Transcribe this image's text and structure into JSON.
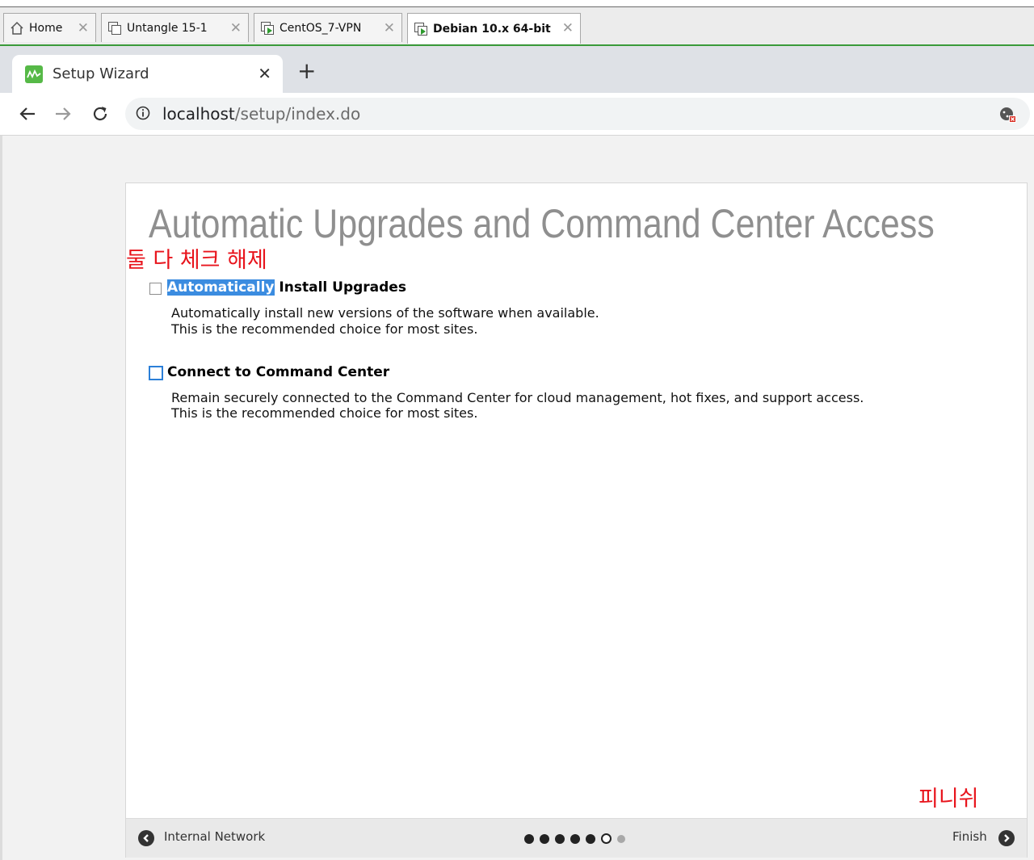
{
  "vm_tabs": [
    {
      "label": "Home",
      "icon": "home-icon"
    },
    {
      "label": "Untangle 15-1",
      "icon": "vm-icon"
    },
    {
      "label": "CentOS_7-VPN",
      "icon": "vm-running-icon"
    },
    {
      "label": "Debian 10.x 64-bit",
      "icon": "vm-running-icon",
      "active": true
    }
  ],
  "browser": {
    "tab_title": "Setup Wizard",
    "url_host": "localhost",
    "url_path": "/setup/index.do"
  },
  "wizard": {
    "title": "Automatic Upgrades and Command Center Access",
    "options": [
      {
        "label_highlight": "Automatically",
        "label_rest": " Install Upgrades",
        "checked": false,
        "desc_line1": "Automatically install new versions of the software when available.",
        "desc_line2": "This is the recommended choice for most sites."
      },
      {
        "label": "Connect to Command Center",
        "checked": false,
        "desc_line1": "Remain securely connected to the Command Center for cloud management, hot fixes, and support access.",
        "desc_line2": "This is the recommended choice for most sites."
      }
    ],
    "footer": {
      "prev_label": "Internal Network",
      "next_label": "Finish",
      "steps_completed": 5,
      "current_step": 6,
      "total_steps": 7
    }
  },
  "annotations": {
    "uncheck_both": "둘 다 체크 해제",
    "finish": "피니쉬"
  },
  "colors": {
    "accent_green": "#3a9a3a",
    "annotation_red": "#e8141c",
    "highlight_blue": "#3b8ce0"
  }
}
